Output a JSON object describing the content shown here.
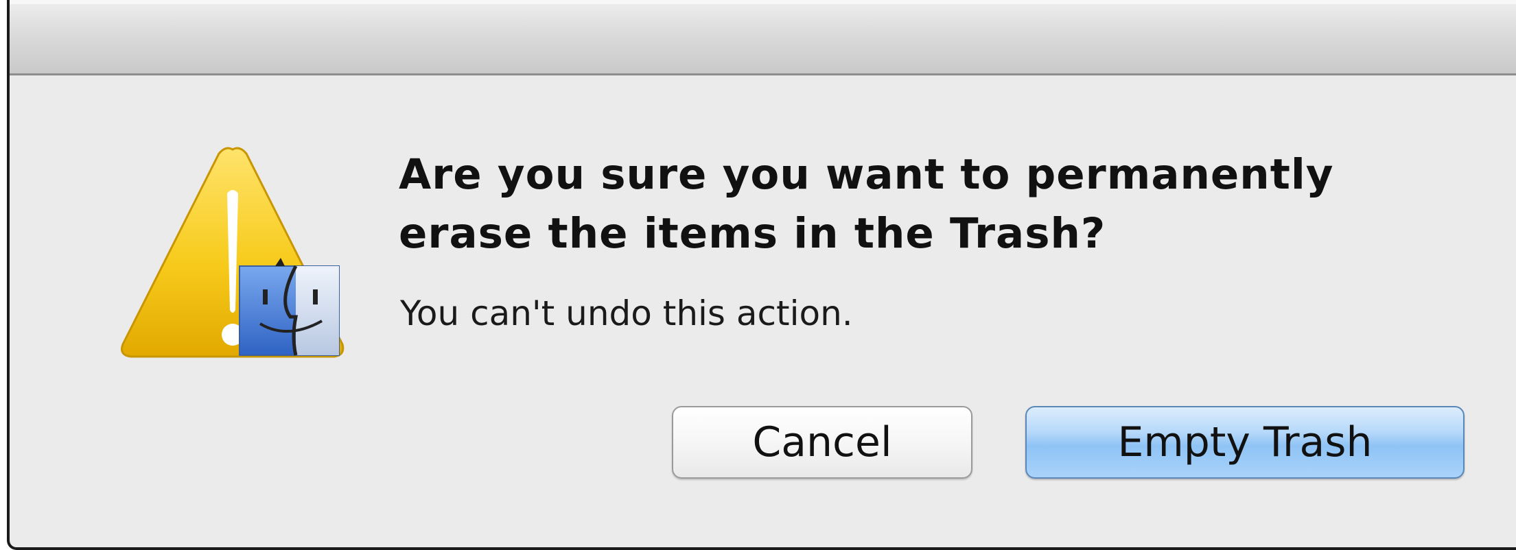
{
  "dialog": {
    "headline": "Are you sure you want to permanently erase the items in the Trash?",
    "message": "You can't undo this action.",
    "icon": "caution-finder-icon",
    "buttons": {
      "cancel_label": "Cancel",
      "confirm_label": "Empty Trash"
    }
  },
  "colors": {
    "dialog_background": "#ebebeb",
    "default_button": "#8fc3f5",
    "warning_yellow": "#f5c518"
  }
}
